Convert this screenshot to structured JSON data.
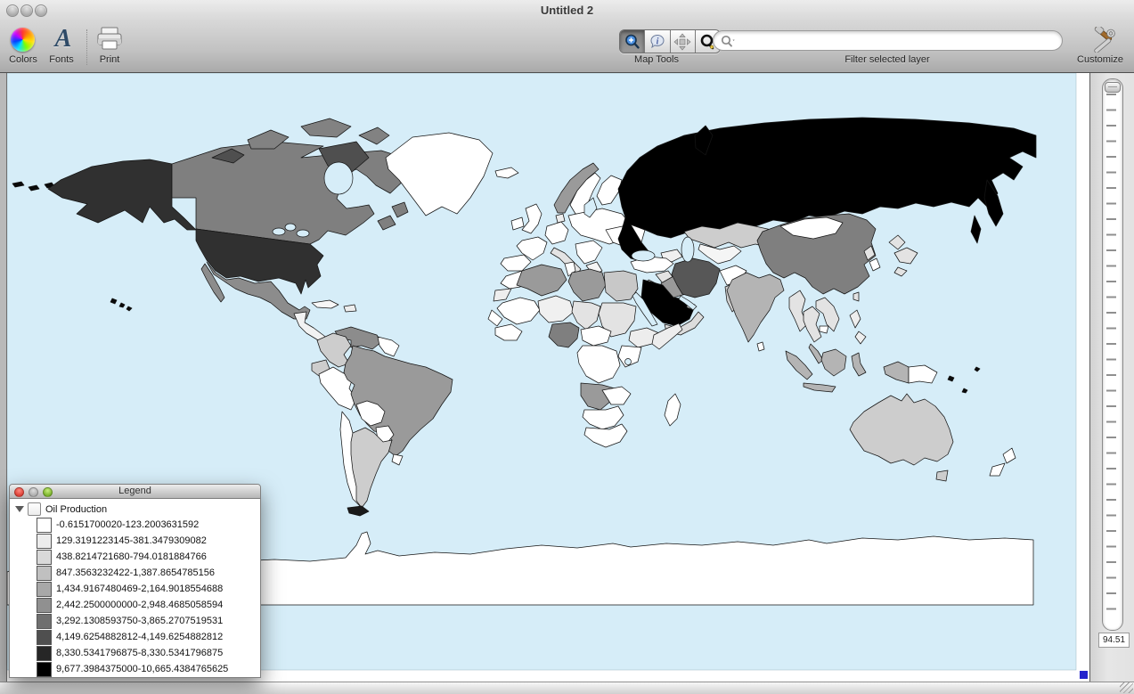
{
  "window": {
    "title": "Untitled 2"
  },
  "toolbar": {
    "colors_label": "Colors",
    "fonts_label": "Fonts",
    "fonts_icon_glyph": "A",
    "print_label": "Print",
    "map_tools_label": "Map Tools",
    "filter_label": "Filter selected layer",
    "customize_label": "Customize",
    "search_placeholder": ""
  },
  "map": {
    "ocean_color": "#d6edf8",
    "zoom_value": "94.51",
    "selection_handle_color": "#2222cc",
    "region_colors": {
      "alaska": "#303030",
      "aleutians": "#0a0a0a",
      "hawaii": "#0a0a0a",
      "canada": "#7f7f7f",
      "arctic-dark": "#4f4f4f",
      "arctic-light": "#828282",
      "greenland": "#ffffff",
      "usa": "#303030",
      "mexico": "#8c8c8c",
      "central-america": "#f2f2f2",
      "cuba": "#f7f7f7",
      "hispaniola": "#ededed",
      "colombia": "#cdcdcd",
      "venezuela": "#8c8c8c",
      "guyanas": "#ffffff",
      "ecuador": "#cdcdcd",
      "peru": "#ffffff",
      "brazil": "#9a9a9a",
      "bolivia": "#ffffff",
      "paraguay": "#ffffff",
      "chile": "#ffffff",
      "argentina": "#cdcdcd",
      "uruguay": "#ffffff",
      "tierra-del-fuego": "#1a1a1a",
      "iceland": "#ffffff",
      "uk": "#ffffff",
      "ireland": "#ffffff",
      "norway": "#9a9a9a",
      "sweden": "#ffffff",
      "finland": "#ffffff",
      "denmark": "#ededed",
      "france": "#ffffff",
      "iberia": "#ffffff",
      "central-europe": "#ffffff",
      "italy": "#e3e3e3",
      "balkans": "#ffffff",
      "greece": "#f5f5f5",
      "eastern-europe": "#ffffff",
      "ukraine": "#ffffff",
      "russia": "#000000",
      "kazakhstan": "#cdcdcd",
      "central-asia": "#f5f5f5",
      "caucasus": "#f0f0f0",
      "turkey": "#ffffff",
      "syria": "#e3e3e3",
      "iraq": "#9a9a9a",
      "iran": "#575757",
      "afghanistan": "#ffffff",
      "pakistan": "#cdcdcd",
      "saudi-arabia": "#000000",
      "yemen-oman": "#dcdcdc",
      "gulf-states": "#e9e9e9",
      "israel-jordan": "#fafafa",
      "morocco": "#ffffff",
      "western-sahara": "#eeeeee",
      "algeria": "#9a9a9a",
      "tunisia": "#ffffff",
      "libya": "#9a9a9a",
      "egypt": "#c8c8c8",
      "mali": "#ffffff",
      "niger": "#f0f0f0",
      "chad": "#e3e3e3",
      "sudan": "#e3e3e3",
      "senegal": "#ffffff",
      "west-africa": "#ffffff",
      "nigeria": "#7f7f7f",
      "cameroon": "#ffffff",
      "ethiopia": "#ededed",
      "somalia": "#ededed",
      "kenya-tanzania": "#ffffff",
      "drc": "#ffffff",
      "angola": "#9a9a9a",
      "zambia": "#ffffff",
      "namibia-botswana": "#ffffff",
      "south-africa": "#ffffff",
      "madagascar": "#ffffff",
      "india": "#b4b4b4",
      "sri-lanka": "#ffffff",
      "myanmar": "#e3e3e3",
      "thailand": "#e3e3e3",
      "vietnam": "#e3e3e3",
      "cambodia": "#ffffff",
      "malaysia": "#b4b4b4",
      "sumatra": "#b4b4b4",
      "java": "#b4b4b4",
      "borneo": "#b4b4b4",
      "sulawesi": "#b4b4b4",
      "philippines": "#eeeeee",
      "taiwan": "#e3e3e3",
      "china": "#7f7f7f",
      "mongolia": "#ffffff",
      "north-korea": "#e3e3e3",
      "south-korea": "#ffffff",
      "japan": "#e3e3e3",
      "west-papua": "#b4b4b4",
      "png": "#ffffff",
      "pacific-islands": "#0a0a0a",
      "australia": "#cdcdcd",
      "tasmania": "#cdcdcd",
      "new-zealand": "#ffffff",
      "antarctica": "#ffffff"
    }
  },
  "legend": {
    "title": "Legend",
    "layer_label": "Oil Production",
    "classes": [
      {
        "color": "#ffffff",
        "label": "-0.6151700020-123.2003631592"
      },
      {
        "color": "#ececec",
        "label": "129.3191223145-381.3479309082"
      },
      {
        "color": "#d9d9d9",
        "label": "438.8214721680-794.0181884766"
      },
      {
        "color": "#c0c0c0",
        "label": "847.3563232422-1,387.8654785156"
      },
      {
        "color": "#a8a8a8",
        "label": "1,434.9167480469-2,164.9018554688"
      },
      {
        "color": "#909090",
        "label": "2,442.2500000000-2,948.4685058594"
      },
      {
        "color": "#6f6f6f",
        "label": "3,292.1308593750-3,865.2707519531"
      },
      {
        "color": "#4f4f4f",
        "label": "4,149.6254882812-4,149.6254882812"
      },
      {
        "color": "#262626",
        "label": "8,330.5341796875-8,330.5341796875"
      },
      {
        "color": "#000000",
        "label": "9,677.3984375000-10,665.4384765625"
      }
    ]
  }
}
